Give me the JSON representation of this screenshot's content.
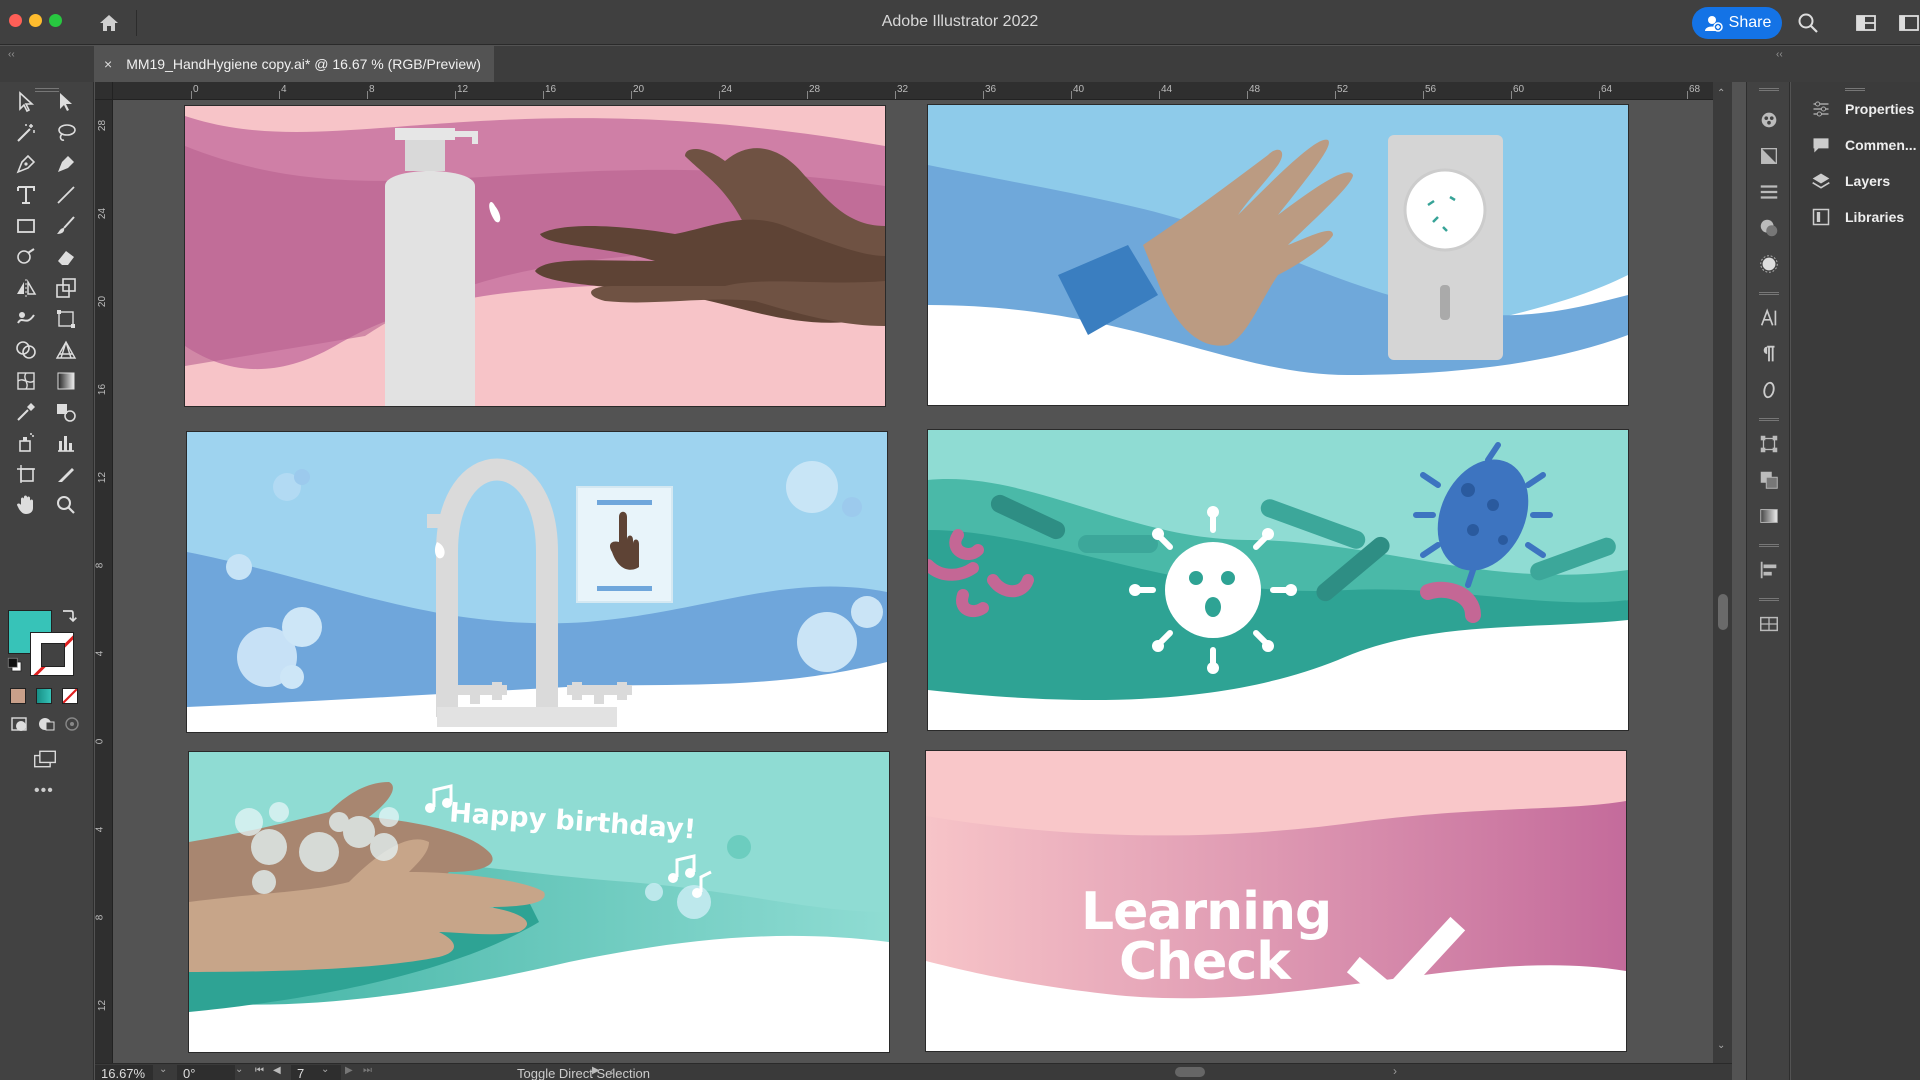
{
  "window": {
    "app_title": "Adobe Illustrator 2022",
    "share_label": "Share"
  },
  "document_tab": {
    "close_glyph": "×",
    "title": "MM19_HandHygiene copy.ai* @ 16.67 % (RGB/Preview)"
  },
  "rulers": {
    "horizontal": [
      "0",
      "4",
      "8",
      "12",
      "16",
      "20",
      "24",
      "28",
      "32",
      "36",
      "40",
      "44",
      "48",
      "52",
      "56",
      "60",
      "64",
      "68"
    ],
    "vertical": [
      "28",
      "24",
      "20",
      "16",
      "12",
      "8",
      "4",
      "0",
      "4",
      "8",
      "12"
    ]
  },
  "artboards": [
    {
      "id": 1,
      "scene": "soap-dispenser-hands"
    },
    {
      "id": 2,
      "scene": "hand-pressing-dispenser"
    },
    {
      "id": 3,
      "scene": "faucet-with-sign"
    },
    {
      "id": 4,
      "scene": "germs-and-virus"
    },
    {
      "id": 5,
      "scene": "hands-washing",
      "text": "Happy birthday!"
    },
    {
      "id": 6,
      "scene": "learning-check",
      "text_line1": "Learning",
      "text_line2": "Check"
    }
  ],
  "statusbar": {
    "zoom": "16.67%",
    "rotation": "0°",
    "artboard_number": "7",
    "status_text": "Toggle Direct Selection"
  },
  "colors": {
    "fill_swatch": "#37c3b8",
    "stroke_swatch": "#ffffff",
    "accent": "#1473e6"
  },
  "right_panels": [
    {
      "label": "Properties",
      "icon": "properties-icon"
    },
    {
      "label": "Commen...",
      "icon": "comments-icon"
    },
    {
      "label": "Layers",
      "icon": "layers-icon"
    },
    {
      "label": "Libraries",
      "icon": "libraries-icon"
    }
  ],
  "toolbar": {
    "more_tools": "•••"
  }
}
